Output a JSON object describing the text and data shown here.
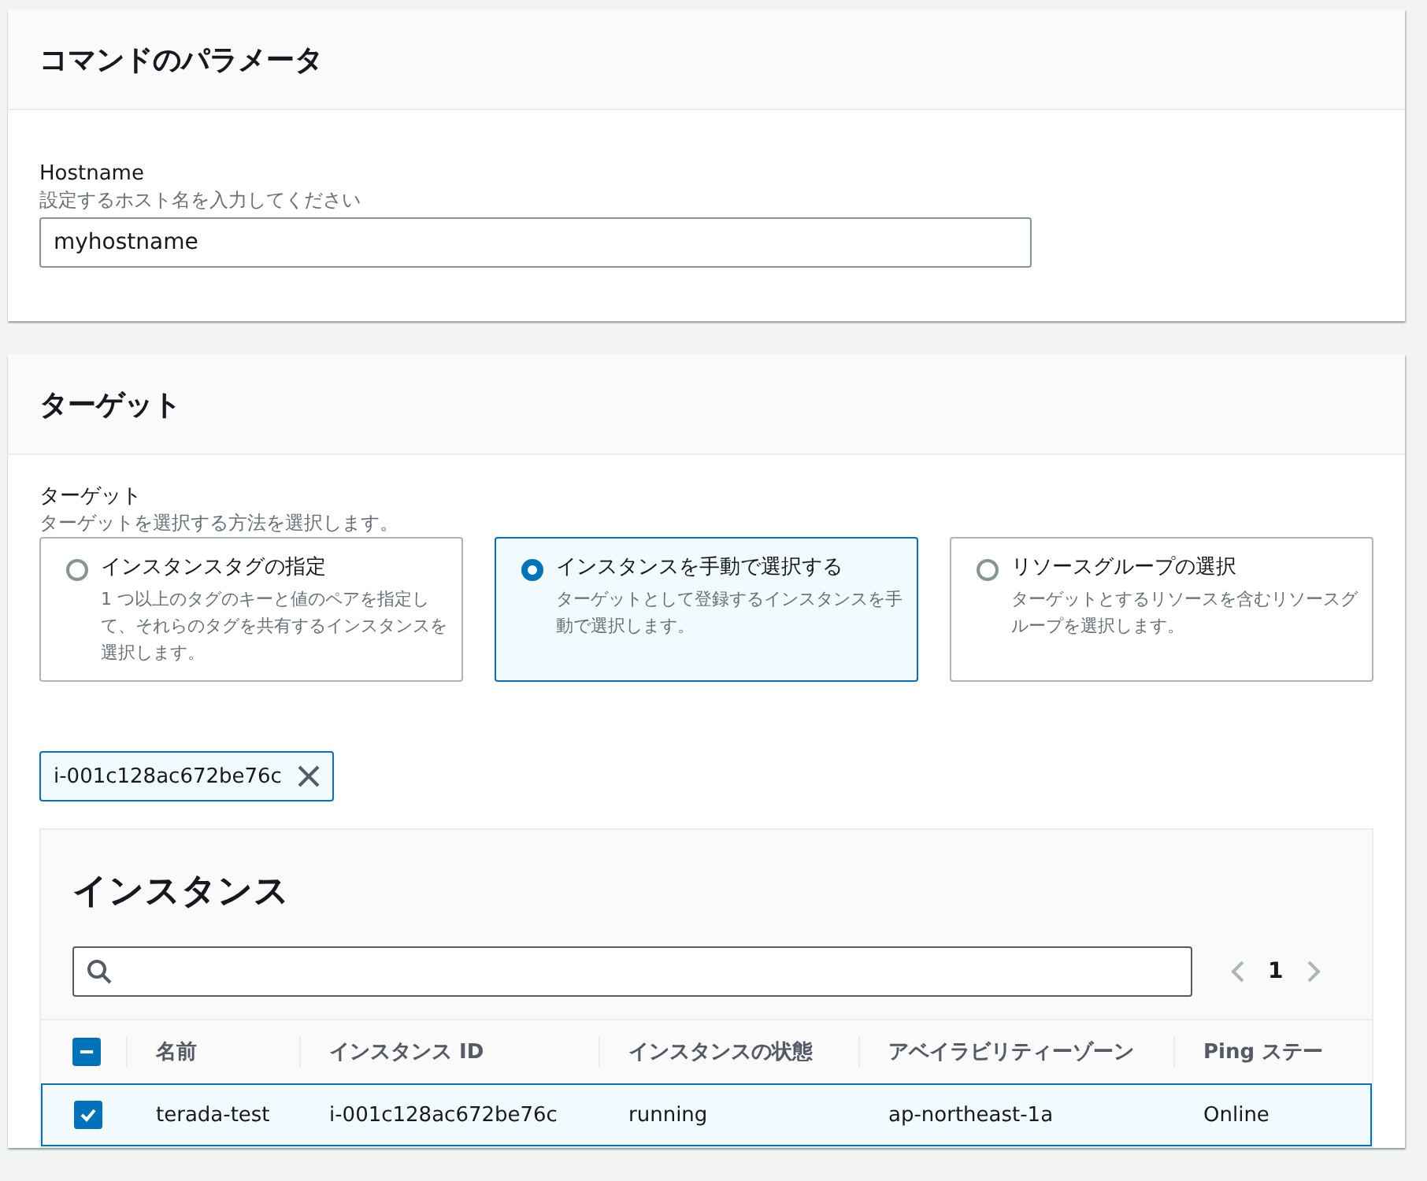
{
  "parameters_panel": {
    "title": "コマンドのパラメータ",
    "field": {
      "label": "Hostname",
      "description": "設定するホスト名を入力してください",
      "value": "myhostname"
    }
  },
  "target_panel": {
    "title": "ターゲット",
    "label": "ターゲット",
    "description": "ターゲットを選択する方法を選択します。",
    "options": [
      {
        "title": "インスタンスタグの指定",
        "description": "1 つ以上のタグのキーと値のペアを指定して、それらのタグを共有するインスタンスを選択します。",
        "selected": false
      },
      {
        "title": "インスタンスを手動で選択する",
        "description": "ターゲットとして登録するインスタンスを手動で選択します。",
        "selected": true
      },
      {
        "title": "リソースグループの選択",
        "description": "ターゲットとするリソースを含むリソースグループを選択します。",
        "selected": false
      }
    ],
    "tokens": [
      "i-001c128ac672be76c"
    ],
    "instances": {
      "title": "インスタンス",
      "page": "1",
      "select_all": {
        "indeterminate": true
      },
      "columns": [
        "名前",
        "インスタンス ID",
        "インスタンスの状態",
        "アベイラビリティーゾーン",
        "Ping ステー"
      ],
      "rows": [
        {
          "cells": [
            "terada-test",
            "i-001c128ac672be76c",
            "running",
            "ap-northeast-1a",
            "Online"
          ],
          "selected": true
        }
      ]
    }
  }
}
